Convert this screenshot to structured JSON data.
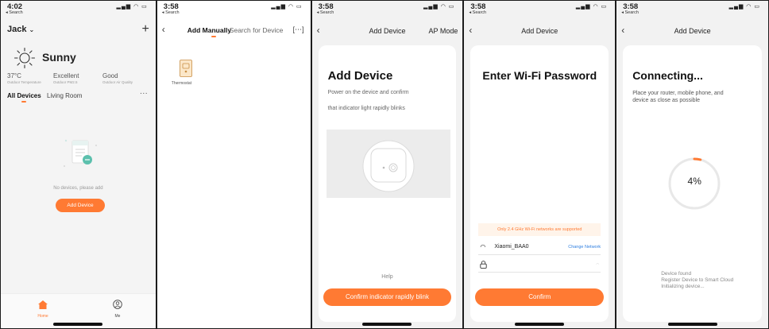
{
  "colors": {
    "accent": "#ff7a33",
    "notice_bg": "#fff4ea",
    "link": "#2f7fe0"
  },
  "screens": [
    {
      "status": {
        "time": "4:02",
        "back": "◂ Search"
      },
      "user": "Jack",
      "weather": {
        "condition": "Sunny",
        "icon": "sun-icon"
      },
      "stats": [
        {
          "value": "37°C",
          "label": "Outdoor Temperature"
        },
        {
          "value": "Excellent",
          "label": "Outdoor PM2.5"
        },
        {
          "value": "Good",
          "label": "Outdoor Air Quality"
        }
      ],
      "tabs": [
        "All Devices",
        "Living Room"
      ],
      "empty_text": "No devices, please add",
      "add_button": "Add Device",
      "tabbar": [
        {
          "label": "Home",
          "icon": "home-icon"
        },
        {
          "label": "Me",
          "icon": "profile-icon"
        }
      ]
    },
    {
      "status": {
        "time": "3:58",
        "back": "◂ Search"
      },
      "tabs": [
        "Add Manually",
        "Search for Device"
      ],
      "device": {
        "label": "Thermostat",
        "icon": "thermostat-icon"
      }
    },
    {
      "status": {
        "time": "3:58",
        "back": "◂ Search"
      },
      "title": "Add Device",
      "right_action": "AP Mode",
      "heading": "Add Device",
      "lines": [
        "Power on the device and confirm",
        "that indicator light rapidly blinks"
      ],
      "help": "Help",
      "button": "Confirm indicator rapidly blink"
    },
    {
      "status": {
        "time": "3:58",
        "back": "◂ Search"
      },
      "title": "Add Device",
      "heading": "Enter Wi-Fi Password",
      "notice": "Only 2.4 GHz Wi-Fi networks are supported",
      "network": "Xiaomi_BAA0",
      "change": "Change Network",
      "button": "Confirm"
    },
    {
      "status": {
        "time": "3:58",
        "back": "◂ Search"
      },
      "title": "Add Device",
      "heading": "Connecting...",
      "lines": [
        "Place your router, mobile phone, and",
        "device as close as possible"
      ],
      "progress_percent": 4,
      "progress_text": "4%",
      "steps": [
        "Device found",
        "Register Device to Smart Cloud",
        "Initializing device..."
      ]
    }
  ]
}
